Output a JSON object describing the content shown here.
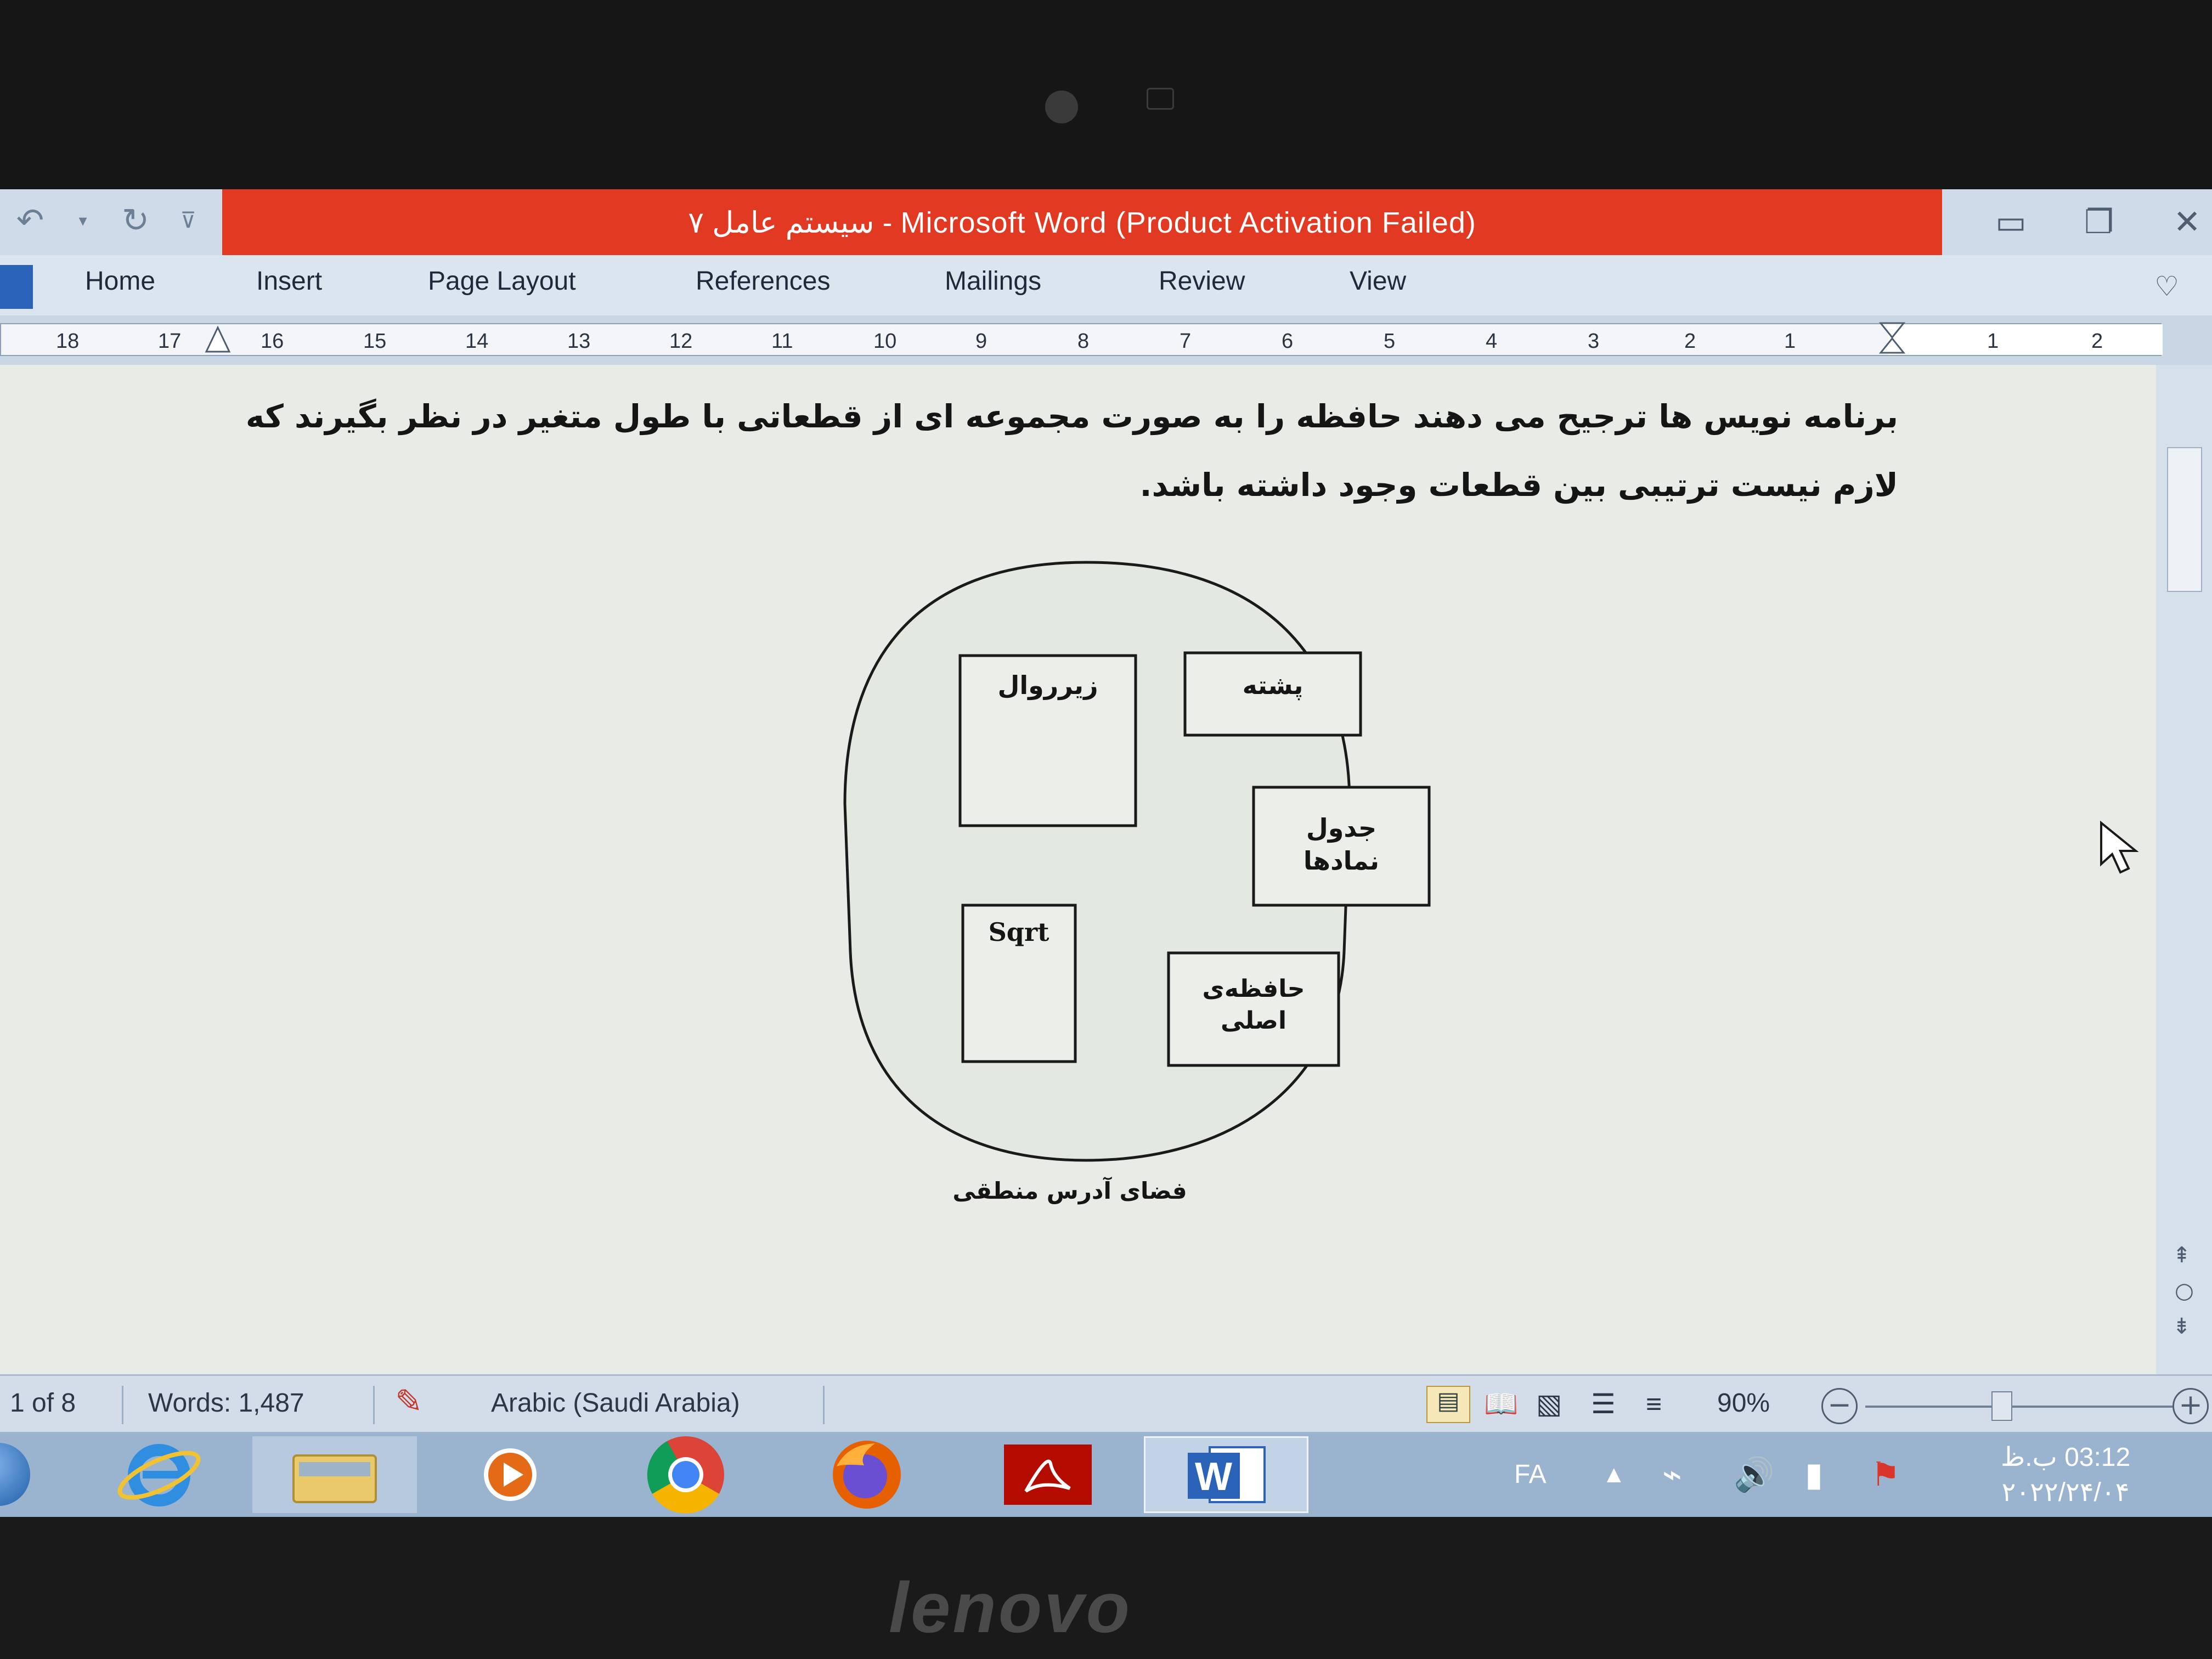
{
  "window": {
    "title": "سیستم عامل ۷  -  Microsoft Word (Product Activation Failed)"
  },
  "ribbon": {
    "tabs": [
      "Home",
      "Insert",
      "Page Layout",
      "References",
      "Mailings",
      "Review",
      "View"
    ]
  },
  "ruler": {
    "numbers": [
      "18",
      "17",
      "16",
      "15",
      "14",
      "13",
      "12",
      "11",
      "10",
      "9",
      "8",
      "7",
      "6",
      "5",
      "4",
      "3",
      "2",
      "1",
      "1",
      "2"
    ]
  },
  "document": {
    "paragraph_line1": "برنامه نویس ها ترجیح می دهند حافظه را به صورت مجموعه ای از قطعاتی با طول متغیر در نظر بگیرند که",
    "paragraph_line2": "لازم نیست ترتیبی بین قطعات وجود داشته باشد.",
    "diagram": {
      "box_subroutine": "زیرروال",
      "box_stack": "پشته",
      "box_symbol_table_line1": "جدول",
      "box_symbol_table_line2": "نمادها",
      "box_sqrt": "Sqrt",
      "box_main_memory_line1": "حافظه‌ی",
      "box_main_memory_line2": "اصلی",
      "caption": "فضای آدرس منطقی"
    }
  },
  "status_bar": {
    "page": "1 of 8",
    "words": "Words: 1,487",
    "language": "Arabic (Saudi Arabia)",
    "zoom": "90%"
  },
  "taskbar": {
    "apps": [
      "internet-explorer",
      "file-explorer",
      "media-player",
      "chrome",
      "firefox",
      "acrobat-reader",
      "word"
    ],
    "tray_lang": "FA",
    "time": "03:12 ب.ظ",
    "date": "۲۰۲۲/۲۴/۰۴"
  },
  "laptop": {
    "brand": "lenovo"
  },
  "colors": {
    "title_bar_red": "#e23a22",
    "word_blue": "#2a63b8",
    "taskbar": "#9ab3cf"
  }
}
